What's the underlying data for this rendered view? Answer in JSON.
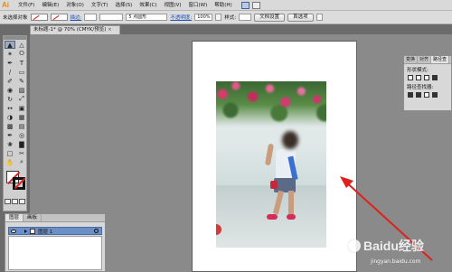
{
  "app": {
    "logo": "Ai"
  },
  "menu": [
    "文件(F)",
    "编辑(E)",
    "对象(O)",
    "文字(T)",
    "选择(S)",
    "效果(C)",
    "视图(V)",
    "窗口(W)",
    "帮助(H)"
  ],
  "control_bar": {
    "no_selection": "未选择对象",
    "stroke_label": "描边:",
    "brush_value": "5 点圆形",
    "opacity_label": "不透明度:",
    "opacity_value": "100%",
    "style_label": "样式:",
    "doc_setup_button": "文档设置",
    "preferences_button": "首选项"
  },
  "document": {
    "tab_title": "未标题-1* @ 70% (CMYK/预览)",
    "close": "×"
  },
  "appearance_panel": {
    "tabs": [
      "变换",
      "对齐",
      "路径查"
    ],
    "shape_modes_label": "形状模式:",
    "pathfinder_label": "路径查找器:"
  },
  "layers_panel": {
    "tabs": [
      "图层",
      "画板"
    ],
    "layer_name": "图层 1"
  },
  "watermark": {
    "text": "Baidu经验",
    "sub": "jingyan.baidu.com"
  },
  "colors": {
    "arrow": "#e0201c",
    "layer_highlight": "#6d8fc7"
  }
}
